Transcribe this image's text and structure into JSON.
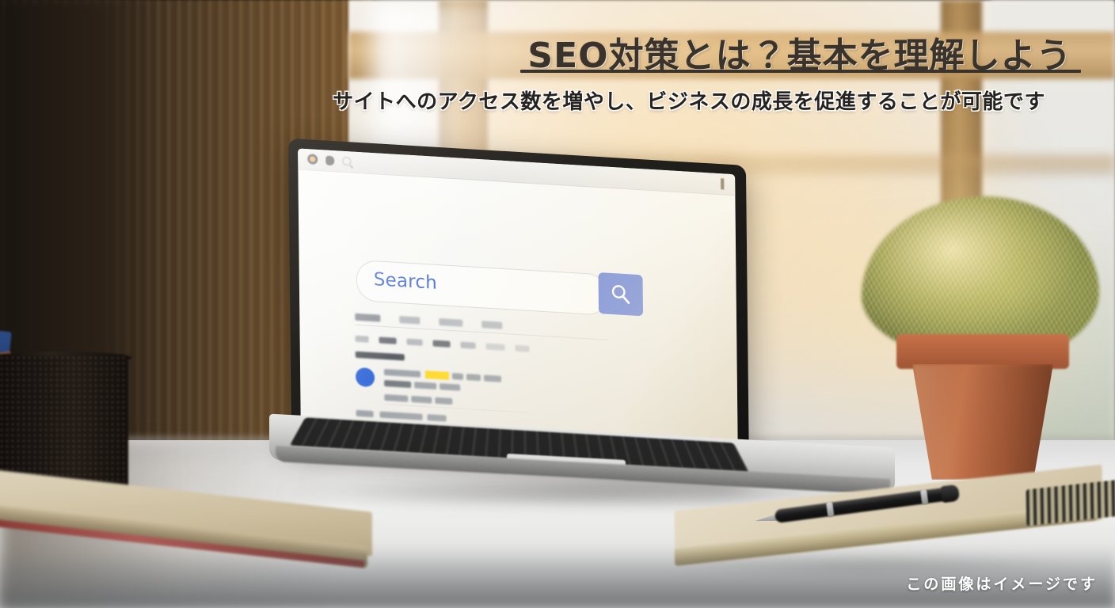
{
  "banner": {
    "title": "SEO対策とは？基本を理解しよう",
    "subtitle": "サイトへのアクセス数を増やし、ビジネスの成長を促進することが可能です",
    "credit": "この画像はイメージです",
    "title_color": "#3a332b",
    "subtitle_color": "#262220",
    "credit_color": "#ffffff",
    "accent_band_color": "#d8b27c"
  },
  "scene": {
    "description": "デスクの上のノートパソコン、観葉植物、ペン立て、ノートとペン",
    "desk_color": "#eaeaea",
    "wall_color": "#4a3823",
    "window_light_color": "#f3efe7"
  },
  "laptop_screen": {
    "browser": {
      "icons": [
        "profile-icon",
        "bookmark-icon",
        "search-icon"
      ],
      "menu_icon": "kebab-menu-icon"
    },
    "search": {
      "placeholder": "Search",
      "text_color": "#4b72d4",
      "button_color": "#7289d8",
      "button_icon": "magnifier-icon"
    },
    "tabs": [
      "",
      "",
      "",
      ""
    ],
    "filters": [
      "",
      "",
      "",
      "",
      "",
      "",
      ""
    ],
    "result_count_line": "",
    "results": [
      {
        "avatar_color": "#2b62d6",
        "highlight_color": "#ffd91e"
      },
      {
        "avatar_color": "",
        "highlight_color": ""
      },
      {
        "avatar_color": "",
        "highlight_color": ""
      }
    ]
  }
}
